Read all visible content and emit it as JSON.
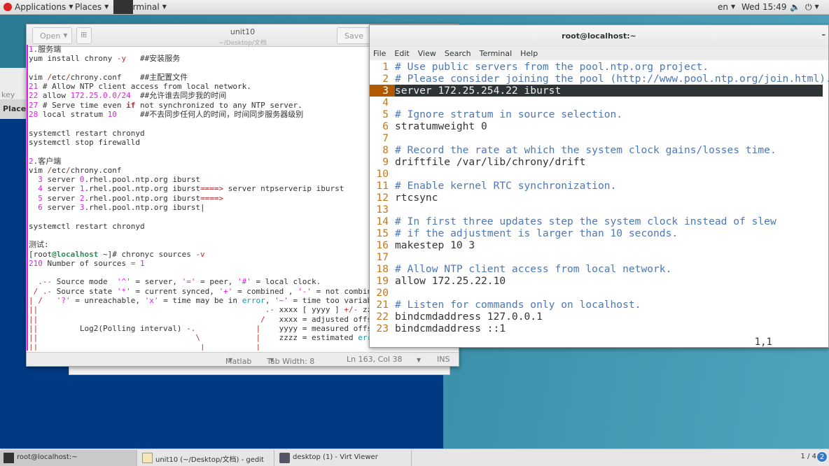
{
  "topbar": {
    "applications": "Applications",
    "places": "Places",
    "terminal": "Terminal",
    "lang": "en",
    "clock": "Wed 15:49"
  },
  "bgwindow": {
    "key": "key",
    "places": "Places"
  },
  "gedit": {
    "open": "Open",
    "save": "Save",
    "title": "unit10",
    "subtitle": "~/Desktop/文档",
    "status": {
      "lang": "Matlab",
      "tab": "Tab Width: 8",
      "pos": "Ln 163, Col 38",
      "mode": "INS"
    },
    "lines": [
      [
        [
          "1",
          "num"
        ],
        [
          ".服务端",
          ""
        ]
      ],
      [
        [
          "yum install chrony ",
          ""
        ],
        [
          "-y",
          "red"
        ],
        [
          "   ##安装服务",
          ""
        ]
      ],
      [],
      [
        [
          "vim ",
          ""
        ],
        [
          "/",
          "red"
        ],
        [
          "etc",
          ""
        ],
        [
          "/",
          "red"
        ],
        [
          "chrony.conf    ##主配置文件",
          ""
        ]
      ],
      [
        [
          "21",
          "num"
        ],
        [
          " # Allow NTP client access from local network.",
          ""
        ]
      ],
      [
        [
          "22",
          "num"
        ],
        [
          " allow ",
          ""
        ],
        [
          "172.25.0.0/24",
          "num"
        ],
        [
          "  ##允许谁去同步我的时间",
          ""
        ]
      ],
      [
        [
          "27",
          "num"
        ],
        [
          " # Serve time even ",
          ""
        ],
        [
          "if",
          "kw"
        ],
        [
          " not synchronized to any NTP server.",
          ""
        ]
      ],
      [
        [
          "28",
          "num"
        ],
        [
          " local stratum ",
          ""
        ],
        [
          "10",
          "num"
        ],
        [
          "     ##不去同步任何人的时间，时间同步服务器级别",
          ""
        ]
      ],
      [],
      [
        [
          "systemctl restart chronyd",
          ""
        ]
      ],
      [
        [
          "systemctl stop firewalld",
          ""
        ]
      ],
      [],
      [
        [
          "2",
          "num"
        ],
        [
          ".客户端",
          ""
        ]
      ],
      [
        [
          "vim ",
          ""
        ],
        [
          "/",
          "red"
        ],
        [
          "etc",
          ""
        ],
        [
          "/",
          "red"
        ],
        [
          "chrony.conf",
          ""
        ]
      ],
      [
        [
          "  3",
          "num"
        ],
        [
          " server ",
          ""
        ],
        [
          "0",
          "num"
        ],
        [
          ".rhel.pool.ntp.org iburst",
          ""
        ]
      ],
      [
        [
          "  4",
          "num"
        ],
        [
          " server ",
          ""
        ],
        [
          "1",
          "num"
        ],
        [
          ".rhel.pool.ntp.org iburst",
          ""
        ],
        [
          "====>",
          "red"
        ],
        [
          " server ntpserverip iburst",
          ""
        ]
      ],
      [
        [
          "  5",
          "num"
        ],
        [
          " server ",
          ""
        ],
        [
          "2",
          "num"
        ],
        [
          ".rhel.pool.ntp.org iburst",
          ""
        ],
        [
          "====>",
          "red"
        ]
      ],
      [
        [
          "  6",
          "num"
        ],
        [
          " server ",
          ""
        ],
        [
          "3",
          "num"
        ],
        [
          ".rhel.pool.ntp.org iburst|",
          ""
        ]
      ],
      [],
      [
        [
          "systemctl restart chronyd",
          ""
        ]
      ],
      [],
      [
        [
          "测试:",
          ""
        ]
      ],
      [
        [
          "[root",
          ""
        ],
        [
          "@localhost",
          "green"
        ],
        [
          " ~]# chronyc sources ",
          ""
        ],
        [
          "-v",
          "red"
        ]
      ],
      [
        [
          "210",
          "num"
        ],
        [
          " Number of sources ",
          ""
        ],
        [
          "=",
          "num"
        ],
        [
          " ",
          ""
        ],
        [
          "1",
          "num"
        ]
      ],
      [],
      [
        [
          "  ",
          ""
        ],
        [
          ".--",
          "red"
        ],
        [
          " Source mode  ",
          ""
        ],
        [
          "'^'",
          "num"
        ],
        [
          " = server, ",
          ""
        ],
        [
          "'='",
          "num"
        ],
        [
          " = peer, ",
          ""
        ],
        [
          "'#'",
          "num"
        ],
        [
          " = local clock.",
          ""
        ]
      ],
      [
        [
          " ",
          ""
        ],
        [
          "/ .-",
          "red"
        ],
        [
          " Source state ",
          ""
        ],
        [
          "'*'",
          "num"
        ],
        [
          " = current synced, ",
          ""
        ],
        [
          "'+'",
          "num"
        ],
        [
          " = combined , ",
          ""
        ],
        [
          "'-'",
          "num"
        ],
        [
          " = not combined,",
          ""
        ]
      ],
      [
        [
          "| /",
          "red"
        ],
        [
          "   ",
          ""
        ],
        [
          "'?'",
          "num"
        ],
        [
          " = unreachable, ",
          ""
        ],
        [
          "'x'",
          "num"
        ],
        [
          " = time may be in ",
          ""
        ],
        [
          "error",
          "teal"
        ],
        [
          ", ",
          ""
        ],
        [
          "'~'",
          "num"
        ],
        [
          " = time too variable.",
          ""
        ]
      ],
      [
        [
          "||",
          "red"
        ],
        [
          "                                                 ",
          ""
        ],
        [
          ".-",
          "red"
        ],
        [
          " xxxx [ yyyy ] ",
          ""
        ],
        [
          "+/-",
          "red"
        ],
        [
          " zzzz",
          ""
        ]
      ],
      [
        [
          "||",
          "red"
        ],
        [
          "                                                ",
          ""
        ],
        [
          "/",
          "red"
        ],
        [
          "   xxxx = adjusted offset,",
          ""
        ]
      ],
      [
        [
          "||",
          "red"
        ],
        [
          "         Log2(Polling interval) ",
          ""
        ],
        [
          "-.",
          "red"
        ],
        [
          "             ",
          ""
        ],
        [
          "|",
          "red"
        ],
        [
          "    yyyy = measured offset,",
          ""
        ]
      ],
      [
        [
          "||",
          "red"
        ],
        [
          "                                  ",
          ""
        ],
        [
          "\\",
          "red"
        ],
        [
          "            ",
          ""
        ],
        [
          "|",
          "red"
        ],
        [
          "    zzzz = estimated ",
          ""
        ],
        [
          "error",
          "teal"
        ],
        [
          ".",
          ""
        ]
      ],
      [
        [
          "||",
          "red"
        ],
        [
          "                                   ",
          ""
        ],
        [
          "|",
          "red"
        ],
        [
          "           ",
          ""
        ],
        [
          "|",
          "red"
        ]
      ]
    ]
  },
  "terminal": {
    "title": "root@localhost:~",
    "minimize": "–",
    "menu": [
      "File",
      "Edit",
      "View",
      "Search",
      "Terminal",
      "Help"
    ],
    "current_line": 3,
    "lines": [
      {
        "n": "1",
        "t": "# Use public servers from the pool.ntp.org project.",
        "k": "comment"
      },
      {
        "n": "2",
        "t": "# Please consider joining the pool (http://www.pool.ntp.org/join.html).",
        "k": "comment"
      },
      {
        "n": "3",
        "t": "server 172.25.254.22 iburst",
        "k": ""
      },
      {
        "n": "4",
        "t": "",
        "k": ""
      },
      {
        "n": "5",
        "t": "# Ignore stratum in source selection.",
        "k": "comment"
      },
      {
        "n": "6",
        "t": "stratumweight 0",
        "k": ""
      },
      {
        "n": "7",
        "t": "",
        "k": ""
      },
      {
        "n": "8",
        "t": "# Record the rate at which the system clock gains/losses time.",
        "k": "comment"
      },
      {
        "n": "9",
        "t": "driftfile /var/lib/chrony/drift",
        "k": ""
      },
      {
        "n": "10",
        "t": "",
        "k": ""
      },
      {
        "n": "11",
        "t": "# Enable kernel RTC synchronization.",
        "k": "comment"
      },
      {
        "n": "12",
        "t": "rtcsync",
        "k": ""
      },
      {
        "n": "13",
        "t": "",
        "k": ""
      },
      {
        "n": "14",
        "t": "# In first three updates step the system clock instead of slew",
        "k": "comment"
      },
      {
        "n": "15",
        "t": "# if the adjustment is larger than 10 seconds.",
        "k": "comment"
      },
      {
        "n": "16",
        "t": "makestep 10 3",
        "k": ""
      },
      {
        "n": "17",
        "t": "",
        "k": ""
      },
      {
        "n": "18",
        "t": "# Allow NTP client access from local network.",
        "k": "comment"
      },
      {
        "n": "19",
        "t": "allow 172.25.22.10",
        "k": ""
      },
      {
        "n": "20",
        "t": "",
        "k": ""
      },
      {
        "n": "21",
        "t": "# Listen for commands only on localhost.",
        "k": "comment"
      },
      {
        "n": "22",
        "t": "bindcmdaddress 127.0.0.1",
        "k": ""
      },
      {
        "n": "23",
        "t": "bindcmdaddress ::1",
        "k": ""
      }
    ],
    "cursor_pos": "1,1"
  },
  "taskbar": {
    "tasks": [
      "root@localhost:~",
      "unit10 (~/Desktop/文档) - gedit",
      "desktop (1) - Virt Viewer"
    ],
    "workspace": "1 / 4",
    "workspace_badge": "2"
  }
}
